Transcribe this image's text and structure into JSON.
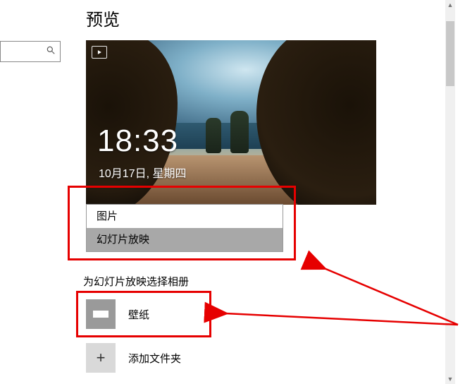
{
  "colors": {
    "annotation": "#e60000"
  },
  "search": {
    "placeholder": ""
  },
  "heading": "预览",
  "preview": {
    "time": "18:33",
    "date": "10月17日, 星期四",
    "badge_icon": "slideshow-icon"
  },
  "background_dropdown": {
    "options": [
      {
        "label": "图片",
        "selected": false
      },
      {
        "label": "幻灯片放映",
        "selected": true
      }
    ]
  },
  "albums": {
    "section_label": "为幻灯片放映选择相册",
    "items": [
      {
        "label": "壁纸"
      }
    ],
    "add_label": "添加文件夹"
  }
}
